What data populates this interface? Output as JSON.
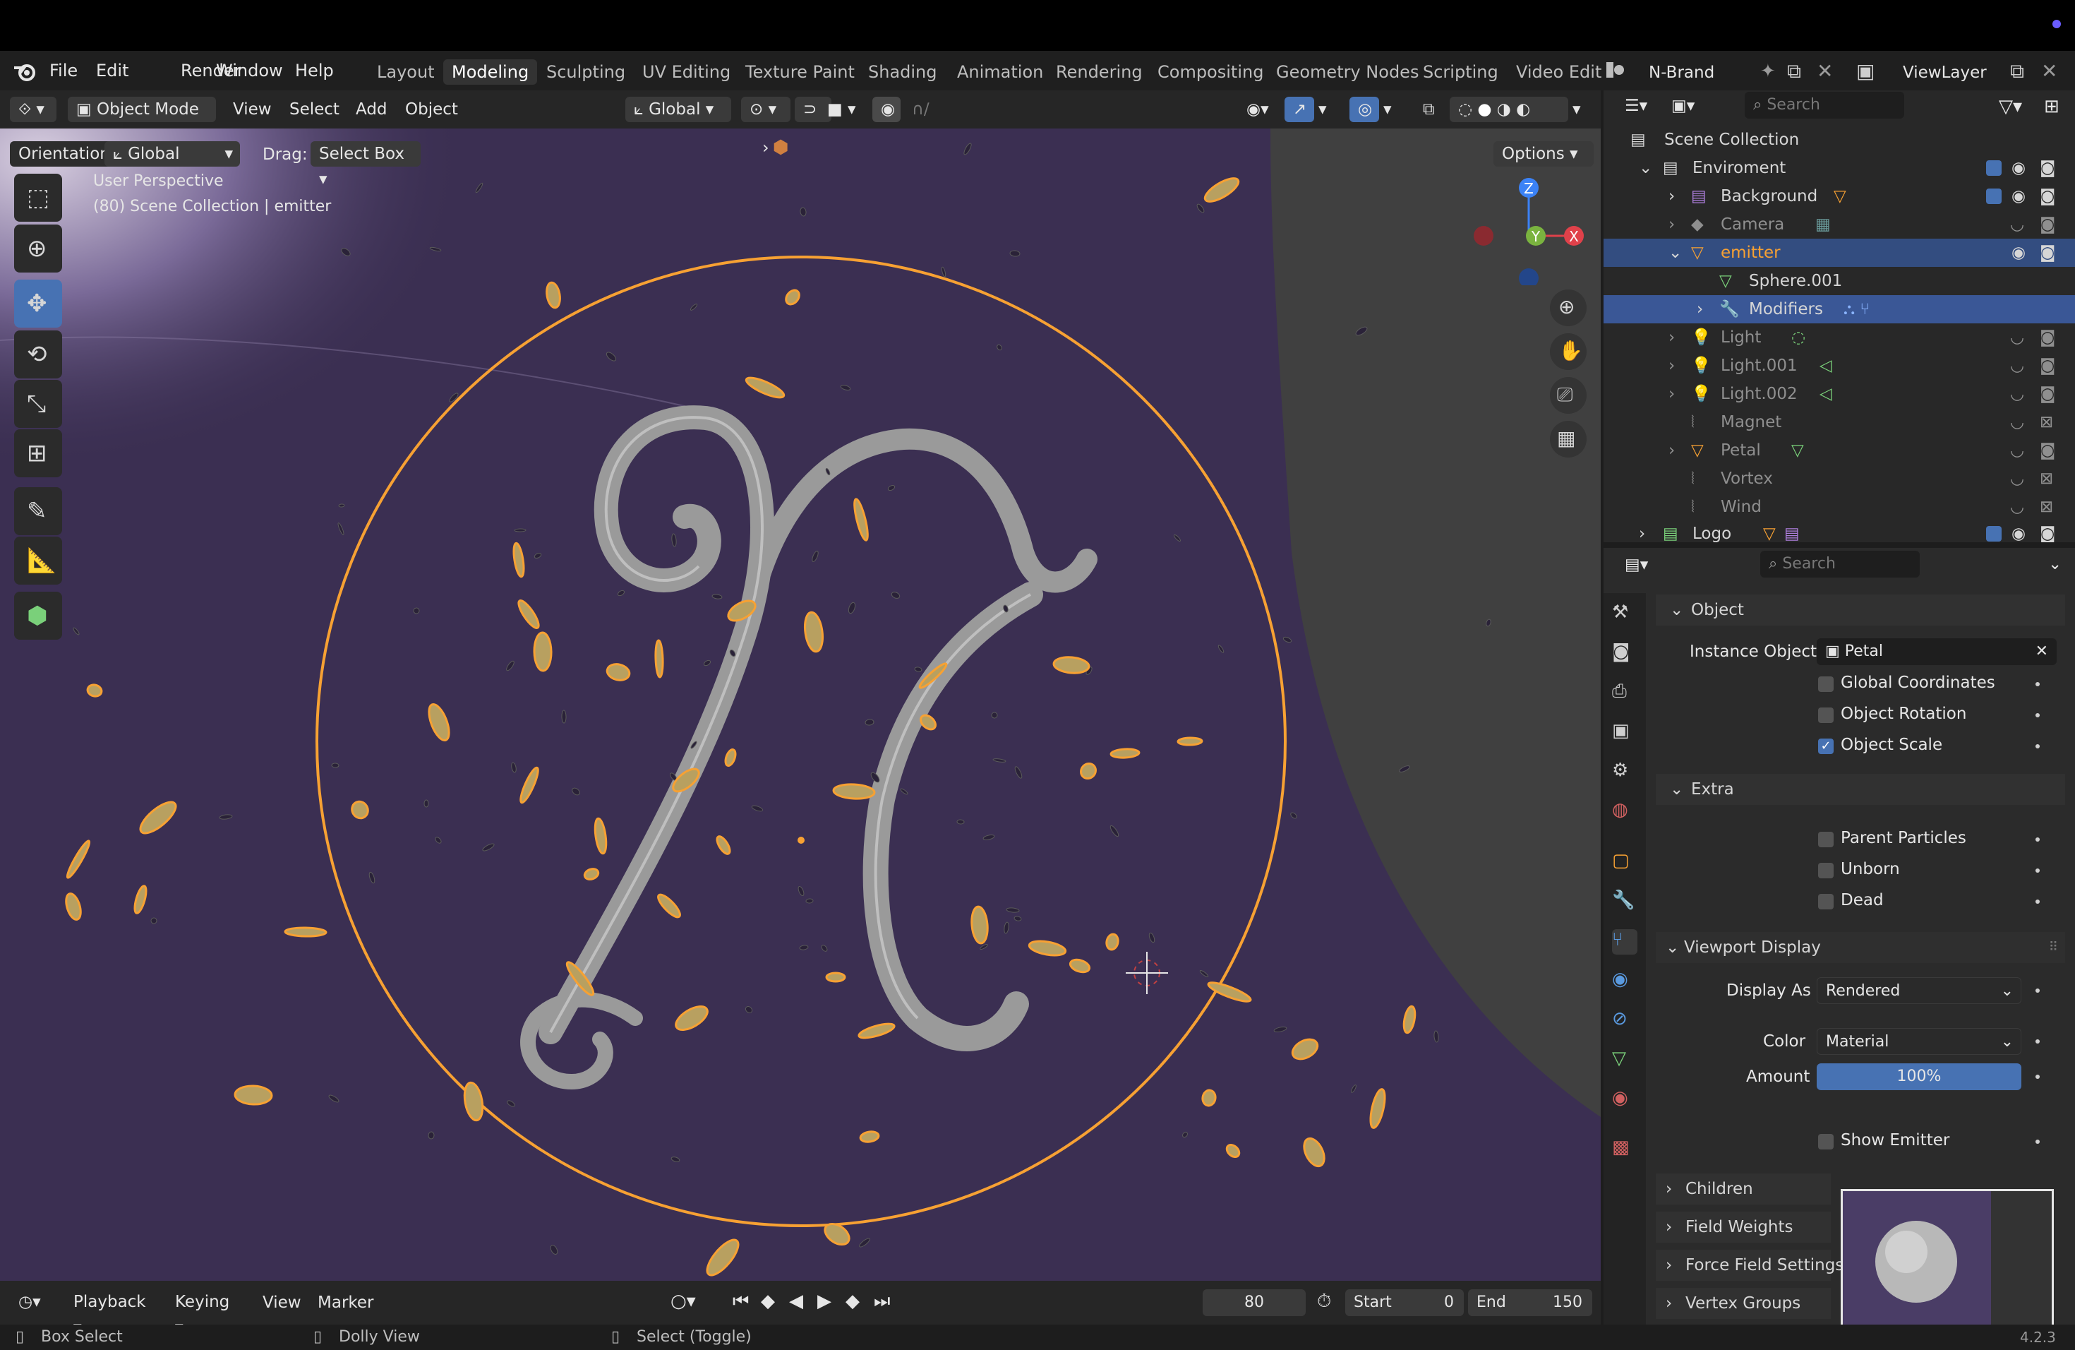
{
  "menu": [
    "File",
    "Edit",
    "Render",
    "Window",
    "Help"
  ],
  "workspaces": [
    "Layout",
    "Modeling",
    "Sculpting",
    "UV Editing",
    "Texture Paint",
    "Shading",
    "Animation",
    "Rendering",
    "Compositing",
    "Geometry Nodes",
    "Scripting",
    "Video Edit"
  ],
  "active_workspace": "Modeling",
  "scene_name": "N-Brand",
  "view_layer": "ViewLayer",
  "header": {
    "mode": "Object Mode",
    "menus": [
      "View",
      "Select",
      "Add",
      "Object"
    ],
    "transform": "Global",
    "orientation_label": "Orientation:",
    "orientation": "Global",
    "drag_label": "Drag:",
    "drag": "Select Box",
    "options": "Options"
  },
  "viewport": {
    "perspective": "User Perspective",
    "collection_info": "(80) Scene Collection | emitter",
    "gizmo": {
      "z": "Z",
      "y": "Y",
      "x": "X"
    }
  },
  "outliner": {
    "search_placeholder": "Search",
    "root": "Scene Collection",
    "rows": [
      {
        "label": "Enviroment"
      },
      {
        "label": "Background"
      },
      {
        "label": "Camera"
      },
      {
        "label": "emitter"
      },
      {
        "label": "Sphere.001"
      },
      {
        "label": "Modifiers"
      },
      {
        "label": "Light"
      },
      {
        "label": "Light.001"
      },
      {
        "label": "Light.002"
      },
      {
        "label": "Magnet"
      },
      {
        "label": "Petal"
      },
      {
        "label": "Vortex"
      },
      {
        "label": "Wind"
      },
      {
        "label": "Logo"
      }
    ]
  },
  "properties": {
    "search_placeholder": "Search",
    "object_panel": "Object",
    "instance_object_label": "Instance Object",
    "instance_object": "Petal",
    "global_coordinates": {
      "label": "Global Coordinates",
      "checked": false
    },
    "object_rotation": {
      "label": "Object Rotation",
      "checked": false
    },
    "object_scale": {
      "label": "Object Scale",
      "checked": true
    },
    "extra_panel": "Extra",
    "parent_particles": {
      "label": "Parent Particles",
      "checked": false
    },
    "unborn": {
      "label": "Unborn",
      "checked": false
    },
    "dead": {
      "label": "Dead",
      "checked": false
    },
    "viewport_display_panel": "Viewport Display",
    "display_as_label": "Display As",
    "display_as": "Rendered",
    "color_label": "Color",
    "color": "Material",
    "amount_label": "Amount",
    "amount": "100%",
    "amount_fraction": 1.0,
    "show_emitter": {
      "label": "Show Emitter",
      "checked": false
    },
    "collapsed_panels": [
      "Children",
      "Field Weights",
      "Force Field Settings",
      "Vertex Groups"
    ]
  },
  "timeline": {
    "menus": [
      "Playback",
      "Keying",
      "View",
      "Marker"
    ],
    "current_frame": "80",
    "start_label": "Start",
    "start": "0",
    "end_label": "End",
    "end": "150"
  },
  "status": {
    "left": "Box Select",
    "middle": "Dolly View",
    "right": "Select (Toggle)",
    "version": "4.2.3"
  },
  "colors": {
    "accent": "#4772b3",
    "selection_orange": "#f7a133",
    "viewport_bg": "#3b2f52",
    "outliner_selected": "#334d80"
  }
}
